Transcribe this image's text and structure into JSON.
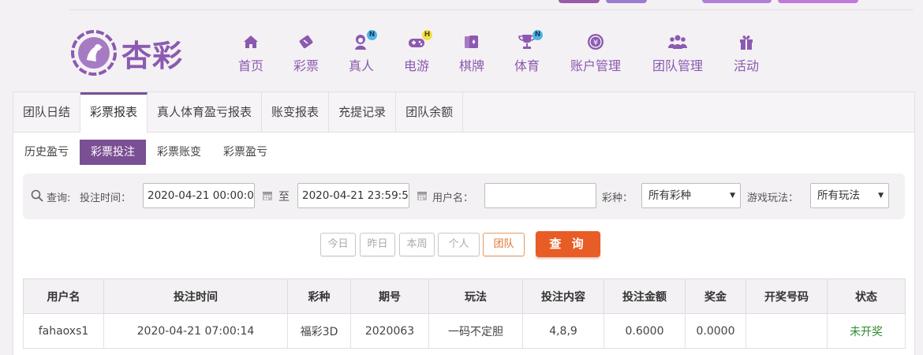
{
  "brand": {
    "name": "杏彩",
    "color": "#8b5ab0"
  },
  "nav": [
    {
      "label": "首页",
      "icon": "home-icon",
      "badge": ""
    },
    {
      "label": "彩票",
      "icon": "lottery-ticket-icon",
      "badge": ""
    },
    {
      "label": "真人",
      "icon": "live-dealer-icon",
      "badge": "N"
    },
    {
      "label": "电游",
      "icon": "gamepad-icon",
      "badge": "H"
    },
    {
      "label": "棋牌",
      "icon": "cards-icon",
      "badge": ""
    },
    {
      "label": "体育",
      "icon": "trophy-icon",
      "badge": "N"
    },
    {
      "label": "账户管理",
      "icon": "account-icon",
      "badge": ""
    },
    {
      "label": "团队管理",
      "icon": "team-icon",
      "badge": ""
    },
    {
      "label": "活动",
      "icon": "gift-icon",
      "badge": ""
    }
  ],
  "tabs": [
    {
      "label": "团队日结",
      "active": false
    },
    {
      "label": "彩票报表",
      "active": true
    },
    {
      "label": "真人体育盈亏报表",
      "active": false
    },
    {
      "label": "账变报表",
      "active": false
    },
    {
      "label": "充提记录",
      "active": false
    },
    {
      "label": "团队余额",
      "active": false
    }
  ],
  "subtabs": [
    {
      "label": "历史盈亏",
      "active": false
    },
    {
      "label": "彩票投注",
      "active": true
    },
    {
      "label": "彩票账变",
      "active": false
    },
    {
      "label": "彩票盈亏",
      "active": false
    }
  ],
  "filter": {
    "query_label": "查询:",
    "time_label": "投注时间：",
    "start_time": "2020-04-21 00:00:00",
    "to_label": "至",
    "end_time": "2020-04-21 23:59:59",
    "username_label": "用户名：",
    "username_value": "",
    "lottery_label": "彩种：",
    "lottery_value": "所有彩种",
    "play_label": "游戏玩法：",
    "play_value": "所有玩法"
  },
  "quick_buttons": {
    "today": "今日",
    "yesterday": "昨日",
    "this_week": "本周",
    "personal": "个人",
    "team": "团队"
  },
  "search_label": "查 询",
  "table": {
    "headers": [
      "用户名",
      "投注时间",
      "彩种",
      "期号",
      "玩法",
      "投注内容",
      "投注金额",
      "奖金",
      "开奖号码",
      "状态"
    ],
    "rows": [
      [
        "fahaoxs1",
        "2020-04-21 07:00:14",
        "福彩3D",
        "2020063",
        "一码不定胆",
        "4,8,9",
        "0.6000",
        "0.0000",
        "",
        "未开奖"
      ]
    ],
    "status_color": "#2e8b2e"
  },
  "colors": {
    "accent": "#7a4f93",
    "search": "#e85c25",
    "team": "#e2732a"
  }
}
